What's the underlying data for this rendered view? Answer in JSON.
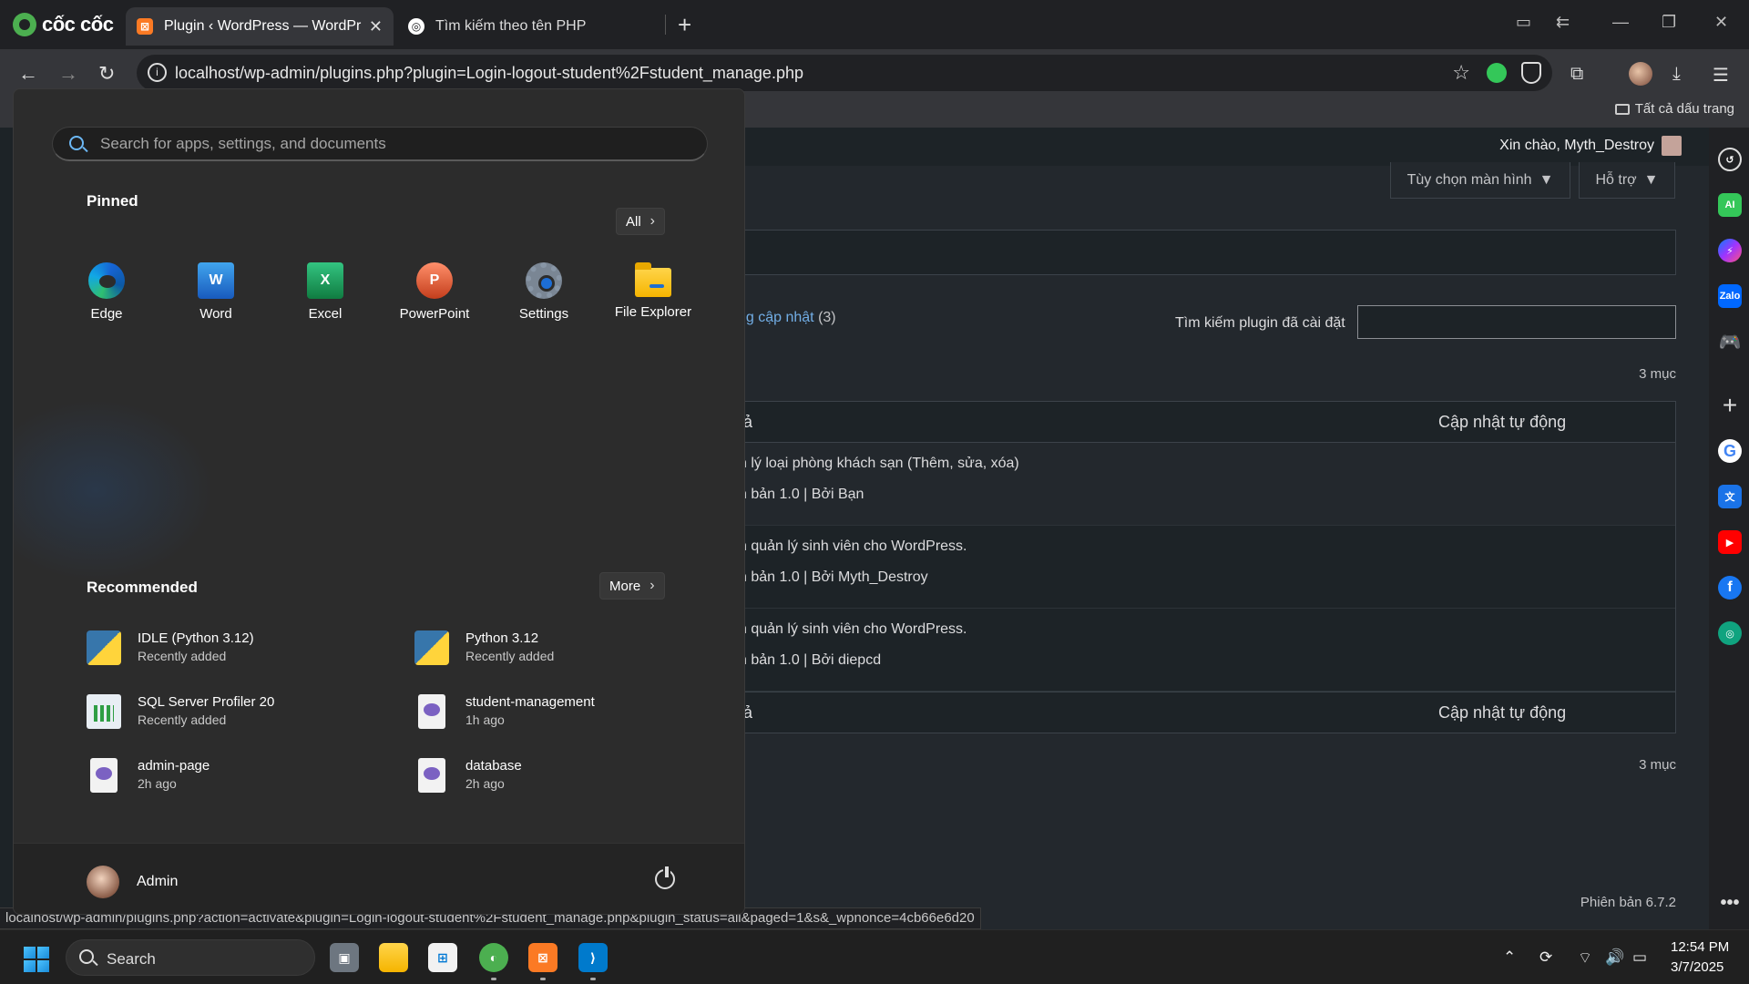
{
  "browser": {
    "brand": "cốc cốc",
    "tabs": [
      {
        "title": "Plugin ‹ WordPress — WordPress",
        "active": true
      },
      {
        "title": "Tìm kiếm theo tên PHP",
        "active": false
      }
    ],
    "url": "localhost/wp-admin/plugins.php?plugin=Login-logout-student%2Fstudent_manage.php",
    "bookmarks_all": "Tất cả dấu trang",
    "status_url": "localhost/wp-admin/plugins.php?action=activate&plugin=Login-logout-student%2Fstudent_manage.php&plugin_status=all&paged=1&s&_wpnonce=4cb66e6d20"
  },
  "wordpress": {
    "greeting": "Xin chào, Myth_Destroy",
    "screen_options": "Tùy chọn màn hình",
    "help": "Hỗ trợ",
    "filter_link": "ng cập nhật",
    "filter_count": "(3)",
    "search_label": "Tìm kiếm plugin đã cài đặt",
    "items_count": "3 mục",
    "col_desc": "tả",
    "col_auto_update": "Cập nhật tự động",
    "rows": [
      {
        "desc": "n lý loại phòng khách sạn (Thêm, sửa, xóa)",
        "meta": "n bản 1.0 | Bởi Bạn"
      },
      {
        "desc": "n quản lý sinh viên cho WordPress.",
        "meta": "n bản 1.0 | Bởi Myth_Destroy"
      },
      {
        "desc": "n quản lý sinh viên cho WordPress.",
        "meta": "n bản 1.0 | Bởi diepcd"
      }
    ],
    "version": "Phiên bản 6.7.2"
  },
  "start_menu": {
    "search_placeholder": "Search for apps, settings, and documents",
    "pinned_title": "Pinned",
    "all_button": "All",
    "pinned": [
      {
        "label": "Edge",
        "icon": "edge-icon"
      },
      {
        "label": "Word",
        "icon": "word-icon"
      },
      {
        "label": "Excel",
        "icon": "excel-icon"
      },
      {
        "label": "PowerPoint",
        "icon": "powerpoint-icon"
      },
      {
        "label": "Settings",
        "icon": "settings-icon"
      },
      {
        "label": "File Explorer",
        "icon": "file-explorer-icon"
      }
    ],
    "recommended_title": "Recommended",
    "more_button": "More",
    "recommended": [
      {
        "name": "IDLE (Python 3.12)",
        "sub": "Recently added",
        "icon": "python-idle-icon"
      },
      {
        "name": "Python 3.12",
        "sub": "Recently added",
        "icon": "python-icon"
      },
      {
        "name": "SQL Server Profiler 20",
        "sub": "Recently added",
        "icon": "sql-profiler-icon"
      },
      {
        "name": "student-management",
        "sub": "1h ago",
        "icon": "php-file-icon"
      },
      {
        "name": "admin-page",
        "sub": "2h ago",
        "icon": "php-file-icon"
      },
      {
        "name": "database",
        "sub": "2h ago",
        "icon": "php-file-icon"
      }
    ],
    "user": "Admin"
  },
  "taskbar": {
    "search_label": "Search",
    "time": "12:54 PM",
    "date": "3/7/2025"
  },
  "colors": {
    "accent": "#4cc2ff",
    "start_bg": "#2c2c2c",
    "wp_link": "#72aee6"
  }
}
